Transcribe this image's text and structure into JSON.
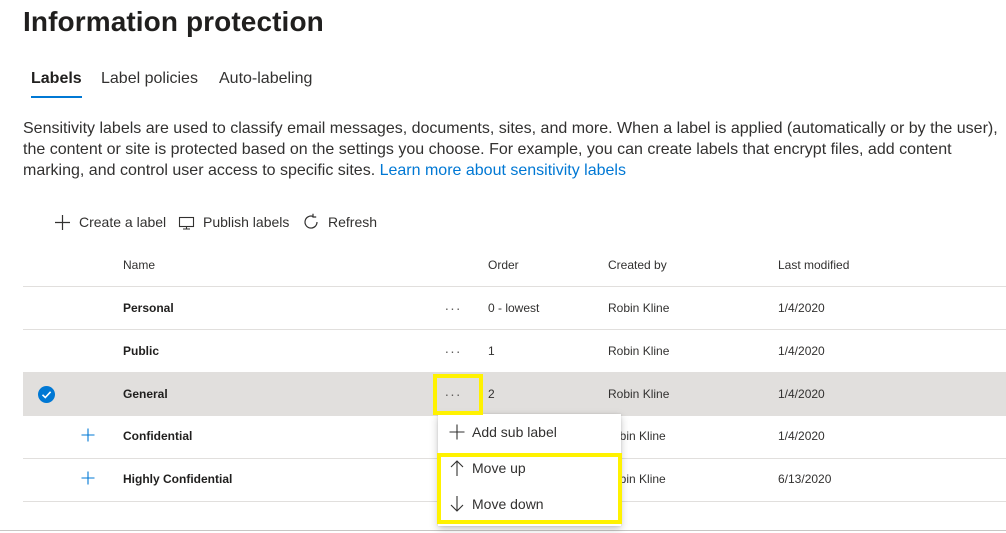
{
  "page": {
    "title": "Information protection"
  },
  "tabs": [
    {
      "label": "Labels",
      "active": true
    },
    {
      "label": "Label policies",
      "active": false
    },
    {
      "label": "Auto-labeling",
      "active": false
    }
  ],
  "description": {
    "text": "Sensitivity labels are used to classify email messages, documents, sites, and more. When a label is applied (automatically or by the user), the content or site is protected based on the settings you choose. For example, you can create labels that encrypt files, add content marking, and control user access to specific sites.",
    "link": "Learn more about sensitivity labels"
  },
  "commands": {
    "create": "Create a label",
    "publish": "Publish labels",
    "refresh": "Refresh"
  },
  "table": {
    "columns": {
      "name": "Name",
      "order": "Order",
      "created_by": "Created by",
      "last_modified": "Last modified"
    },
    "rows": [
      {
        "name": "Personal",
        "more": "···",
        "order": "0 - lowest",
        "created_by": "Robin Kline",
        "last_modified": "1/4/2020"
      },
      {
        "name": "Public",
        "more": "···",
        "order": "1",
        "created_by": "Robin Kline",
        "last_modified": "1/4/2020"
      },
      {
        "name": "General",
        "more": "···",
        "order": "2",
        "created_by": "Robin Kline",
        "last_modified": "1/4/2020"
      },
      {
        "name": "Confidential",
        "more": "",
        "order": "",
        "created_by": "obin Kline",
        "last_modified": "1/4/2020"
      },
      {
        "name": "Highly Confidential",
        "more": "",
        "order": "",
        "created_by": "obin Kline",
        "last_modified": "6/13/2020"
      }
    ]
  },
  "context_menu": {
    "add_sub_label": "Add sub label",
    "move_up": "Move up",
    "move_down": "Move down"
  },
  "colors": {
    "accent": "#0078d4",
    "highlight": "#fff200",
    "selected_row": "#e1dfdd"
  }
}
